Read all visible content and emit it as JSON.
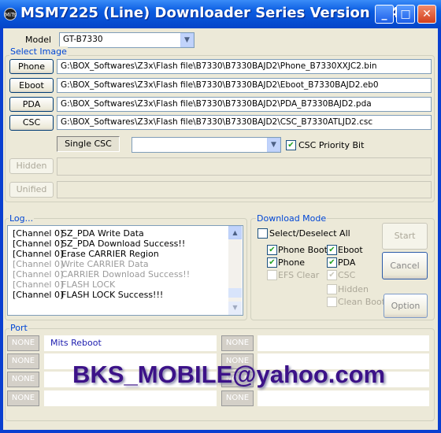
{
  "window": {
    "title": "MSM7225 (Line) Downloader Series Version 9.4",
    "icon_text": "MiTs",
    "minimize": "_",
    "maximize": "□",
    "close": "✕"
  },
  "model": {
    "label": "Model",
    "value": "GT-B7330"
  },
  "select_image": {
    "legend": "Select Image",
    "rows": [
      {
        "button": "Phone",
        "path": "G:\\BOX_Softwares\\Z3x\\Flash file\\B7330\\B7330BAJD2\\Phone_B7330XXJC2.bin"
      },
      {
        "button": "Eboot",
        "path": "G:\\BOX_Softwares\\Z3x\\Flash file\\B7330\\B7330BAJD2\\Eboot_B7330BAJD2.eb0"
      },
      {
        "button": "PDA",
        "path": "G:\\BOX_Softwares\\Z3x\\Flash file\\B7330\\B7330BAJD2\\PDA_B7330BAJD2.pda"
      },
      {
        "button": "CSC",
        "path": "G:\\BOX_Softwares\\Z3x\\Flash file\\B7330\\B7330BAJD2\\CSC_B7330ATLJD2.csc"
      }
    ],
    "single_csc": "Single CSC",
    "single_csc_value": "",
    "csc_priority_label": "CSC Priority Bit",
    "csc_priority_checked": true,
    "hidden": {
      "button": "Hidden",
      "path": ""
    },
    "unified": {
      "button": "Unified",
      "path": ""
    }
  },
  "log": {
    "legend": "Log...",
    "lines": [
      {
        "ch": "[Channel 0]",
        "msg": "SZ_PDA Write Data"
      },
      {
        "ch": "[Channel 0]",
        "msg": "SZ_PDA Download Success!!"
      },
      {
        "ch": "[Channel 0]",
        "msg": "Erase CARRIER Region"
      },
      {
        "ch": "[Channel 0]",
        "msg": "Write CARRIER Data"
      },
      {
        "ch": "[Channel 0]",
        "msg": "CARRIER Download Success!!"
      },
      {
        "ch": "[Channel 0]",
        "msg": "FLASH LOCK"
      },
      {
        "ch": "[Channel 0]",
        "msg": "FLASH LOCK Success!!!"
      }
    ]
  },
  "download_mode": {
    "legend": "Download Mode",
    "select_all": "Select/Deselect All",
    "options": [
      {
        "label": "Phone Boot",
        "checked": true,
        "enabled": true
      },
      {
        "label": "Eboot",
        "checked": true,
        "enabled": true
      },
      {
        "label": "Phone",
        "checked": true,
        "enabled": true
      },
      {
        "label": "PDA",
        "checked": true,
        "enabled": true
      },
      {
        "label": "EFS Clear",
        "checked": false,
        "enabled": false
      },
      {
        "label": "CSC",
        "checked": true,
        "enabled": false
      },
      {
        "label": "Hidden",
        "checked": false,
        "enabled": false
      },
      {
        "label": "Clean Boot",
        "checked": false,
        "enabled": false
      }
    ],
    "start": "Start",
    "cancel": "Cancel",
    "option": "Option"
  },
  "port": {
    "legend": "Port",
    "rows": [
      {
        "left_btn": "NONE",
        "left_status": "Mits Reboot",
        "right_btn": "NONE",
        "right_status": ""
      },
      {
        "left_btn": "NONE",
        "left_status": "",
        "right_btn": "NONE",
        "right_status": ""
      },
      {
        "left_btn": "NONE",
        "left_status": "",
        "right_btn": "NONE",
        "right_status": ""
      },
      {
        "left_btn": "NONE",
        "left_status": "",
        "right_btn": "NONE",
        "right_status": ""
      }
    ]
  },
  "watermark": "BKS_MOBILE@yahoo.com"
}
